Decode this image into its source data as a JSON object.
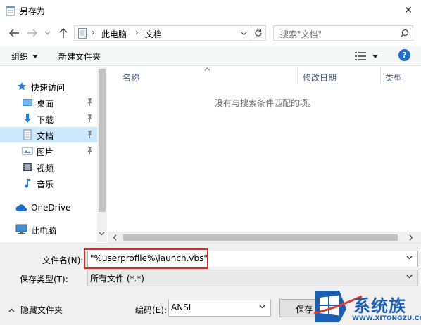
{
  "window": {
    "title": "另存为",
    "close_glyph": "✕"
  },
  "nav": {
    "back_icon": "arrow-left-icon",
    "breadcrumb": [
      "此电脑",
      "文档"
    ],
    "refresh_icon": "refresh-icon",
    "search_placeholder": "搜索\"文档\""
  },
  "toolbar": {
    "organize_label": "组织",
    "newfolder_label": "新建文件夹",
    "help_label": "?"
  },
  "sidebar": {
    "items": [
      {
        "label": "快速访问"
      },
      {
        "label": "桌面"
      },
      {
        "label": "下载"
      },
      {
        "label": "文档"
      },
      {
        "label": "图片"
      },
      {
        "label": "视频"
      },
      {
        "label": "音乐"
      },
      {
        "label": "OneDrive"
      },
      {
        "label": "此电脑"
      }
    ]
  },
  "filelist": {
    "columns": [
      "名称",
      "修改日期",
      "类型"
    ],
    "empty_message": "没有与搜索条件匹配的项。"
  },
  "form": {
    "filename_label": "文件名(N):",
    "filename_value": "\"%userprofile%\\launch.vbs\"",
    "filetype_label": "保存类型(T):",
    "filetype_value": "所有文件  (*.*)",
    "hide_folders_label": "隐藏文件夹",
    "encoding_label": "编码(E):",
    "encoding_value": "ANSI",
    "save_label": "保存"
  },
  "watermark": {
    "brand_text": "系统族",
    "url_text": "WWW.XITONGZU.COM"
  },
  "colors": {
    "accent": "#1f6fcc",
    "highlight": "#cce8ff",
    "red_box": "#d52b22",
    "watermark_blue": "#1a5fb4"
  }
}
